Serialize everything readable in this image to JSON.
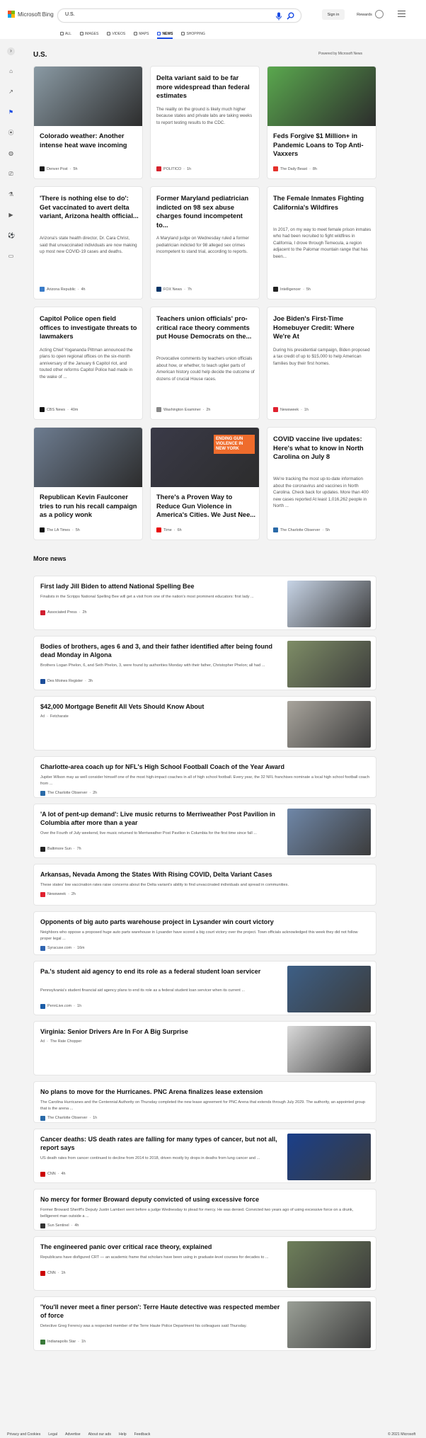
{
  "brand": {
    "name": "Microsoft Bing",
    "colors": [
      "#f25022",
      "#7fba00",
      "#00a4ef",
      "#ffb900"
    ]
  },
  "search": {
    "value": "U.S.",
    "placeholder": ""
  },
  "header": {
    "signin": "Sign in",
    "rewards": "Rewards",
    "medal_icon": "medal-icon",
    "menu_icon": "hamburger-menu-icon"
  },
  "tabs": [
    {
      "label": "ALL",
      "icon": "search-icon"
    },
    {
      "label": "IMAGES",
      "icon": "image-icon"
    },
    {
      "label": "VIDEOS",
      "icon": "video-icon"
    },
    {
      "label": "MAPS",
      "icon": "map-pin-icon"
    },
    {
      "label": "NEWS",
      "icon": "news-icon",
      "active": true
    },
    {
      "label": "SHOPPING",
      "icon": "tag-icon"
    }
  ],
  "accent": "#174ae4",
  "rail_icons": [
    "expand-icon",
    "home-icon",
    "trending-icon",
    "flag-icon",
    "location-icon",
    "globe-icon",
    "briefcase-icon",
    "science-icon",
    "entertainment-icon",
    "sports-icon",
    "money-icon"
  ],
  "section": {
    "title": "U.S.",
    "powered": "Powered by Microsoft News"
  },
  "cards": [
    {
      "title": "Colorado weather: Another intense heat wave incoming",
      "desc": "",
      "source": "Denver Post",
      "time": "5h",
      "img": "#8a9aa4",
      "fav": "#1a1a1a"
    },
    {
      "title": "Delta variant said to be far more widespread than federal estimates",
      "desc": "The reality on the ground is likely much higher because states and private labs are taking weeks to report testing results to the CDC.",
      "source": "POLITICO",
      "time": "1h",
      "img": "",
      "fav": "#d5222c"
    },
    {
      "title": "Feds Forgive $1 Million+ in Pandemic Loans to Top Anti-Vaxxers",
      "desc": "",
      "source": "The Daily Beast",
      "time": "8h",
      "img": "#5aa84e",
      "fav": "#e4312b"
    },
    {
      "title": "'There is nothing else to do': Get vaccinated to avert delta variant, Arizona health official...",
      "desc": "Arizona's state health director, Dr. Cara Christ, said that unvaccinated individuals are now making up most new COVID-19 cases and deaths.",
      "source": "Arizona Republic",
      "time": "4h",
      "img": "",
      "fav": "#3a7bc8"
    },
    {
      "title": "Former Maryland pediatrician indicted on 98 sex abuse charges found incompetent to...",
      "desc": "A Maryland judge on Wednesday ruled a former pediatrician indicted for 98 alleged sex crimes incompetent to stand trial, according to reports.",
      "source": "FOX News",
      "time": "7h",
      "img": "",
      "fav": "#003366"
    },
    {
      "title": "The Female Inmates Fighting California's Wildfires",
      "desc": "In 2017, on my way to meet female prison inmates who had been recruited to fight wildfires in California, I drove through Temecula, a region adjacent to the Palomar mountain range that has been...",
      "source": "Intelligencer",
      "time": "5h",
      "img": "",
      "fav": "#222"
    },
    {
      "title": "Capitol Police open field offices to investigate threats to lawmakers",
      "desc": "Acting Chief Yogananda Pittman announced the plans to open regional offices on the six-month anniversary of the January 6 Capitol riot, and touted other reforms Capitol Police had made in the wake of ...",
      "source": "CBS News",
      "time": "40m",
      "img": "",
      "fav": "#111"
    },
    {
      "title": "Teachers union officials' pro-critical race theory comments put House Democrats on the...",
      "desc": "Provocative comments by teachers union officials about how, or whether, to teach uglier parts of American history could help decide the outcome of dozens of crucial House races.",
      "source": "Washington Examiner",
      "time": "2h",
      "img": "",
      "fav": "#888"
    },
    {
      "title": "Joe Biden's First-Time Homebuyer Credit: Where We're At",
      "desc": "During his presidential campaign, Biden proposed a tax credit of up to $15,000 to help American families buy their first homes.",
      "source": "Newsweek",
      "time": "1h",
      "img": "",
      "fav": "#e0212f"
    },
    {
      "title": "Republican Kevin Faulconer tries to run his recall campaign as a policy wonk",
      "desc": "",
      "source": "The LA Times",
      "time": "5h",
      "img": "#6d7c90",
      "fav": "#111"
    },
    {
      "title": "There's a Proven Way to Reduce Gun Violence in America's Cities. We Just Nee...",
      "desc": "",
      "source": "Time",
      "time": "6h",
      "img": "#3a3a48",
      "fav": "#e90606"
    },
    {
      "title": "COVID vaccine live updates: Here's what to know in North Carolina on July 8",
      "desc": "We're tracking the most up-to-date information about the coronavirus and vaccines in North Carolina. Check back for updates. More than 400 new cases reported At least 1,016,262 people in North ...",
      "source": "The Charlotte Observer",
      "time": "5h",
      "img": "",
      "fav": "#2a6aa8"
    }
  ],
  "card_image_text": "ENDING GUN VIOLENCE IN NEW YORK",
  "more": {
    "title": "More news"
  },
  "rows": [
    {
      "title": "First lady Jill Biden to attend National Spelling Bee",
      "desc": "Finalists in the Scripps National Spelling Bee will get a visit from one of the nation's most prominent educators: first lady ...",
      "source": "Associated Press",
      "time": "2h",
      "img": "#c7d4e6",
      "ad": false,
      "fav": "#d01e2f"
    },
    {
      "title": "Bodies of brothers, ages 6 and 3, and their father identified after being found dead Monday in Algona",
      "desc": "Brothers Logan Phelon, 6, and Seth Phelon, 3, were found by authorities Monday with their father, Christopher Phelon; all had ...",
      "source": "Des Moines Register",
      "time": "3h",
      "img": "#7e8d66",
      "ad": false,
      "fav": "#1d4e9a"
    },
    {
      "title": "$42,000 Mortgage Benefit All Vets Should Know About",
      "desc": "",
      "source": "Fetcharate",
      "time": "",
      "img": "#a8a49c",
      "ad": true,
      "fav": ""
    },
    {
      "title": "Charlotte-area coach up for NFL's High School Football Coach of the Year Award",
      "desc": "Jupiter Wilson may as well consider himself one of the most high-impact coaches in all of high school football. Every year, the 32 NFL franchises nominate a local high school football coach from ...",
      "source": "The Charlotte Observer",
      "time": "2h",
      "img": "",
      "ad": false,
      "fav": "#2a6aa8"
    },
    {
      "title": "'A lot of pent-up demand': Live music returns to Merriweather Post Pavilion in Columbia after more than a year",
      "desc": "Over the Fourth of July weekend, live music returned to Merriweather Post Pavilion in Columbia for the first time since fall ...",
      "source": "Baltimore Sun",
      "time": "7h",
      "img": "#6f87a8",
      "ad": false,
      "fav": "#222"
    },
    {
      "title": "Arkansas, Nevada Among the States With Rising COVID, Delta Variant Cases",
      "desc": "These states' low vaccination rates raise concerns about the Delta variant's ability to find unvaccinated individuals and spread in communities.",
      "source": "Newsweek",
      "time": "2h",
      "img": "",
      "ad": false,
      "fav": "#e0212f"
    },
    {
      "title": "Opponents of big auto parts warehouse project in Lysander win court victory",
      "desc": "Neighbors who oppose a proposed huge auto parts warehouse in Lysander have scored a big court victory over the project. Town officials acknowledged this week they did not follow proper legal ...",
      "source": "Syracuse.com",
      "time": "16m",
      "img": "",
      "ad": false,
      "fav": "#2f64b0"
    },
    {
      "title": "Pa.'s student aid agency to end its role as a federal student loan servicer",
      "desc": "Pennsylvania's student financial aid agency plans to end its role as a federal student loan servicer when its current ...",
      "source": "PennLive.com",
      "time": "1h",
      "img": "#3d5f86",
      "ad": false,
      "fav": "#1b5da8"
    },
    {
      "title": "Virginia: Senior Drivers Are In For A Big Surprise",
      "desc": "",
      "source": "The Rate Chopper",
      "time": "",
      "img": "#d9d9d9",
      "ad": true,
      "fav": ""
    },
    {
      "title": "No plans to move for the Hurricanes. PNC Arena finalizes lease extension",
      "desc": "The Carolina Hurricanes and the Centennial Authority on Thursday completed the new lease agreement for PNC Arena that extends through July 2029. The authority, an appointed group that is the arena ...",
      "source": "The Charlotte Observer",
      "time": "1h",
      "img": "",
      "ad": false,
      "fav": "#2a6aa8"
    },
    {
      "title": "Cancer deaths: US death rates are falling for many types of cancer, but not all, report says",
      "desc": "US death rates from cancer continued to decline from 2014 to 2018, driven mostly by drops in deaths from lung cancer and ...",
      "source": "CNN",
      "time": "4h",
      "img": "#1a3f8a",
      "ad": false,
      "fav": "#cc0000"
    },
    {
      "title": "No mercy for former Broward deputy convicted of using excessive force",
      "desc": "Former Broward Sheriff's Deputy Justin Lambert went before a judge Wednesday to plead for mercy. He was denied. Convicted two years ago of using excessive force on a drunk, belligerent man outside a ...",
      "source": "Sun Sentinel",
      "time": "4h",
      "img": "",
      "ad": false,
      "fav": "#333"
    },
    {
      "title": "The engineered panic over critical race theory, explained",
      "desc": "Republicans have disfigured CRT — an academic frame that scholars have been using in graduate-level courses for decades to ...",
      "source": "CNN",
      "time": "1h",
      "img": "#6e7f5a",
      "ad": false,
      "fav": "#cc0000"
    },
    {
      "title": "'You'll never meet a finer person': Terre Haute detective was respected member of force",
      "desc": "Detective Greg Ferency was a respected member of the Terre Haute Police Department his colleagues said Thursday.",
      "source": "Indianapolis Star",
      "time": "1h",
      "img": "#9a9f96",
      "ad": false,
      "fav": "#3a7a3a"
    }
  ],
  "ad_label": "Ad",
  "footer": {
    "links": [
      "Privacy and Cookies",
      "Legal",
      "Advertise",
      "About our ads",
      "Help",
      "Feedback"
    ],
    "copyright": "© 2021 Microsoft"
  }
}
